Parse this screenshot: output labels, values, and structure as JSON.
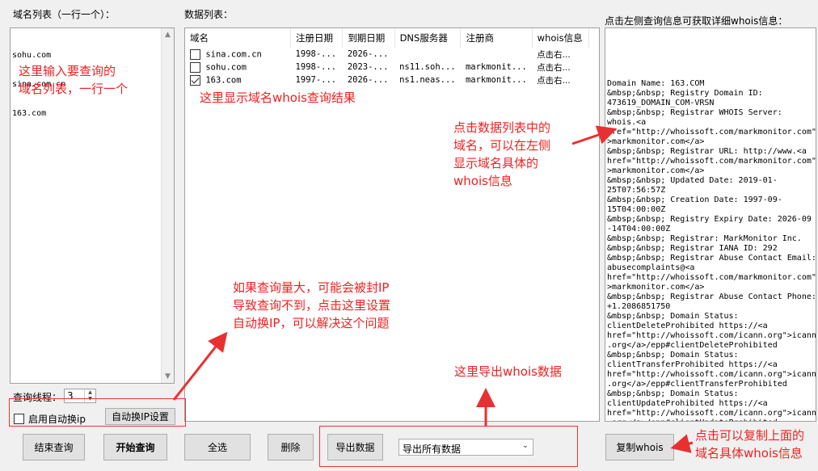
{
  "labels": {
    "domain_list": "域名列表（一行一个）：",
    "data_list": "数据列表：",
    "whois_info": "点击左侧查询信息可获取详细whois信息：",
    "threads": "查询线程："
  },
  "domain_input": {
    "lines": [
      "sohu.com",
      "sina.com.cn",
      "163.com"
    ]
  },
  "table": {
    "headers": [
      "域名",
      "注册日期",
      "到期日期",
      "DNS服务器",
      "注册商",
      "whois信息"
    ],
    "rows": [
      {
        "checked": false,
        "cells": [
          "sina.com.cn",
          "1998-...",
          "2026-...",
          "",
          "",
          "点击右..."
        ]
      },
      {
        "checked": false,
        "cells": [
          "sohu.com",
          "1998-...",
          "2023-...",
          "ns11.soh...",
          "markmonit...",
          "点击右..."
        ]
      },
      {
        "checked": true,
        "cells": [
          "163.com",
          "1997-...",
          "2026-...",
          "ns1.neas...",
          "markmonit...",
          "点击右..."
        ]
      }
    ]
  },
  "whois_text": "Domain Name: 163.COM\n&mbsp;&nbsp; Registry Domain ID:\n473619_DOMAIN_COM-VRSN\n&mbsp;&nbsp; Registrar WHOIS Server:\nwhois.<a\nhref=\"http://whoissoft.com/markmonitor.com\"\n>markmonitor.com</a>\n&mbsp;&nbsp; Registrar URL: http://www.<a\nhref=\"http://whoissoft.com/markmonitor.com\"\n>markmonitor.com</a>\n&mbsp;&nbsp; Updated Date: 2019-01-\n25T07:56:57Z\n&mbsp;&nbsp; Creation Date: 1997-09-\n15T04:00:00Z\n&mbsp;&nbsp; Registry Expiry Date: 2026-09\n-14T04:00:00Z\n&mbsp;&nbsp; Registrar: MarkMonitor Inc.\n&mbsp;&nbsp; Registrar IANA ID: 292\n&mbsp;&nbsp; Registrar Abuse Contact Email:\nabusecomplaints@<a\nhref=\"http://whoissoft.com/markmonitor.com\"\n>markmonitor.com</a>\n&mbsp;&nbsp; Registrar Abuse Contact Phone:\n+1.2086851750\n&mbsp;&nbsp; Domain Status:\nclientDeleteProhibited https://<a\nhref=\"http://whoissoft.com/icann.org\">icann\n.org</a>/epp#clientDeleteProhibited\n&mbsp;&nbsp; Domain Status:\nclientTransferProhibited https://<a\nhref=\"http://whoissoft.com/icann.org\">icann\n.org</a>/epp#clientTransferProhibited\n&mbsp;&nbsp; Domain Status:\nclientUpdateProhibited https://<a\nhref=\"http://whoissoft.com/icann.org\">icann\n.org</a>/epp#clientUpdateProhibited",
  "threads_value": "3",
  "checkbox_auto_ip": {
    "label": "启用自动换ip",
    "checked": false
  },
  "buttons": {
    "auto_ip_settings": "自动换IP设置",
    "stop_query": "结束查询",
    "start_query": "开始查询",
    "select_all": "全选",
    "delete": "删除",
    "export_data": "导出数据",
    "copy_whois": "复制whois"
  },
  "export_select": {
    "value": "导出所有数据"
  },
  "annotations": {
    "input_hint": [
      "这里输入要查询的",
      "域名列表，一行一个"
    ],
    "result_hint": "这里显示域名whois查询结果",
    "click_hint": [
      "点击数据列表中的",
      "域名，可以在左侧",
      "显示域名具体的",
      "whois信息"
    ],
    "ip_hint": [
      "如果查询量大，可能会被封IP",
      "导致查询不到，点击这里设置",
      "自动换IP，可以解决这个问题"
    ],
    "export_hint": "这里导出whois数据",
    "copy_hint": [
      "点击可以复制上面的",
      "域名具体whois信息"
    ]
  },
  "colors": {
    "annotation": "#f02020",
    "arrow": "#e83030"
  }
}
